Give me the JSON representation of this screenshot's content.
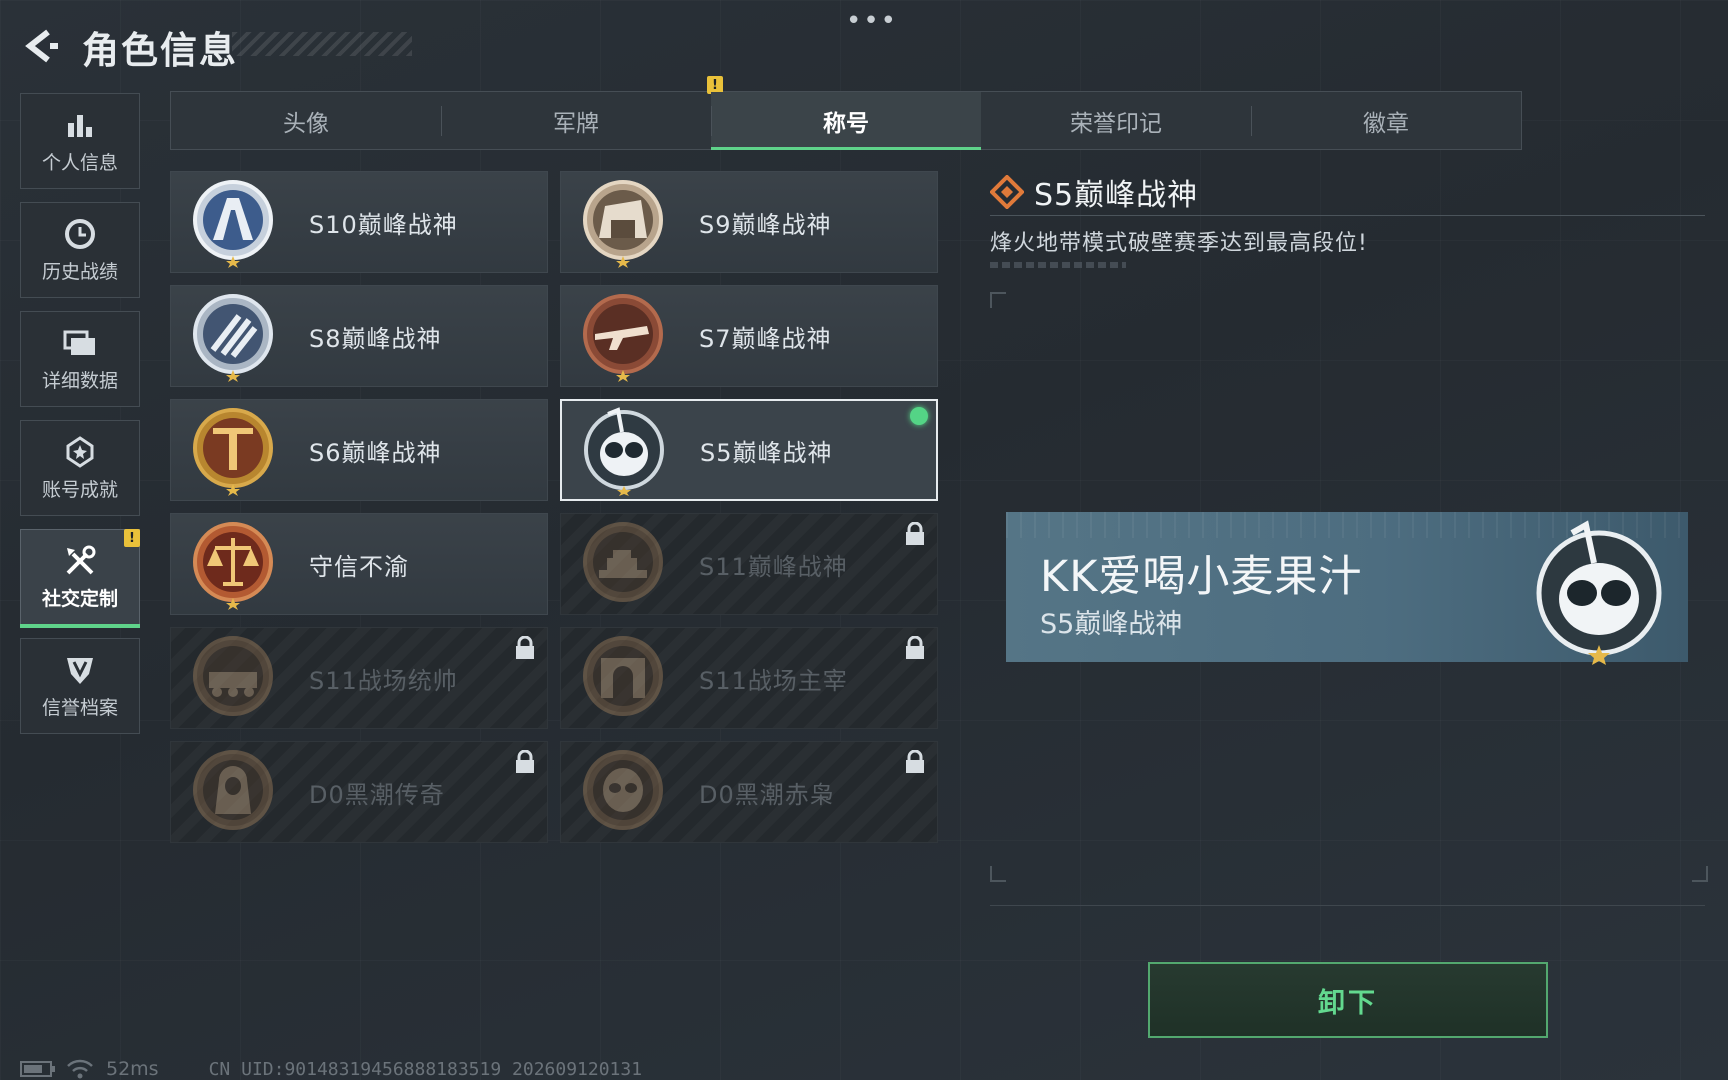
{
  "header": {
    "title": "角色信息",
    "more": "•••"
  },
  "sidebar": {
    "items": [
      {
        "label": "个人信息",
        "icon": "bar-chart-icon"
      },
      {
        "label": "历史战绩",
        "icon": "clock-icon"
      },
      {
        "label": "详细数据",
        "icon": "folder-icon"
      },
      {
        "label": "账号成就",
        "icon": "achievement-icon"
      },
      {
        "label": "社交定制",
        "icon": "tools-icon",
        "active": true,
        "badge": "!"
      },
      {
        "label": "信誉档案",
        "icon": "shield-icon"
      }
    ]
  },
  "tabs": [
    {
      "label": "头像"
    },
    {
      "label": "军牌",
      "badge": "!"
    },
    {
      "label": "称号",
      "active": true
    },
    {
      "label": "荣誉印记"
    },
    {
      "label": "徽章"
    }
  ],
  "titles": [
    {
      "name": "S10巅峰战神",
      "state": "unlocked"
    },
    {
      "name": "S9巅峰战神",
      "state": "unlocked"
    },
    {
      "name": "S8巅峰战神",
      "state": "unlocked"
    },
    {
      "name": "S7巅峰战神",
      "state": "unlocked"
    },
    {
      "name": "S6巅峰战神",
      "state": "unlocked"
    },
    {
      "name": "S5巅峰战神",
      "state": "equipped"
    },
    {
      "name": "守信不渝",
      "state": "unlocked"
    },
    {
      "name": "S11巅峰战神",
      "state": "locked"
    },
    {
      "name": "S11战场统帅",
      "state": "locked"
    },
    {
      "name": "S11战场主宰",
      "state": "locked"
    },
    {
      "name": "D0黑潮传奇",
      "state": "locked"
    },
    {
      "name": "D0黑潮赤枭",
      "state": "locked"
    }
  ],
  "detail": {
    "title": "S5巅峰战神",
    "description": "烽火地带模式破壁赛季达到最高段位!",
    "plate": {
      "player_name": "KK爱喝小麦果汁",
      "title": "S5巅峰战神"
    },
    "unequip_label": "卸下"
  },
  "footer": {
    "ping": "52ms",
    "uid": "CN UID:9014831945688818351​9 202609120131"
  },
  "colors": {
    "accent": "#5fd38a",
    "warn": "#e9c13a",
    "bronze": "#8a5a36",
    "plate": "#4f6f82"
  }
}
